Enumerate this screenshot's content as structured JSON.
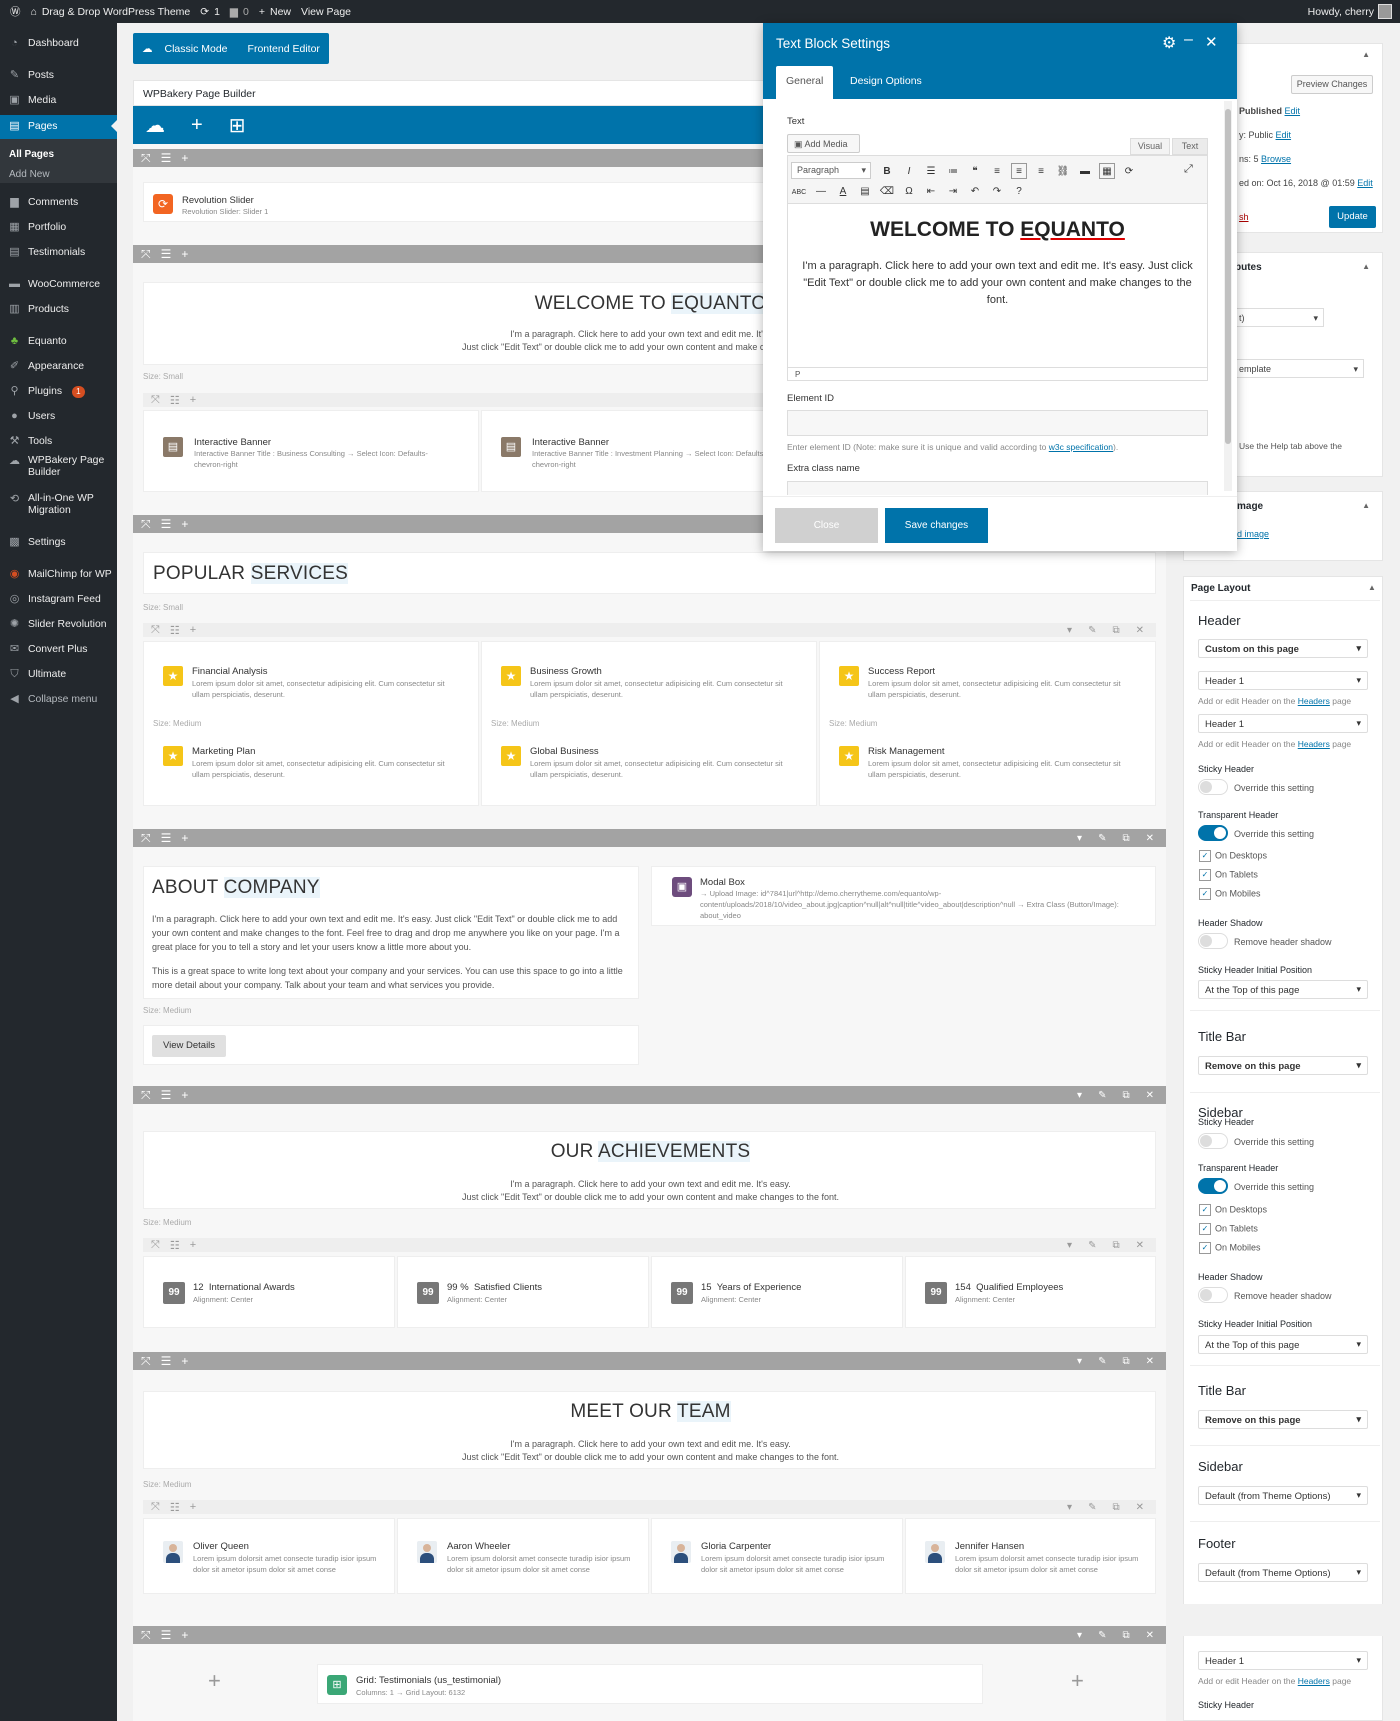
{
  "adminbar": {
    "site": "Drag & Drop WordPress Theme",
    "updates": "1",
    "comments": "0",
    "new": "New",
    "view": "View Page",
    "howdy": "Howdy, cherry"
  },
  "sidebar": {
    "items": [
      "Dashboard",
      "Posts",
      "Media",
      "Pages",
      "Comments",
      "Portfolio",
      "Testimonials",
      "WooCommerce",
      "Products",
      "Equanto",
      "Appearance",
      "Plugins",
      "Users",
      "Tools",
      "WPBakery Page Builder",
      "All-in-One WP Migration",
      "Settings",
      "MailChimp for WP",
      "Instagram Feed",
      "Slider Revolution",
      "Convert Plus",
      "Ultimate",
      "Collapse menu"
    ],
    "subs": [
      "All Pages",
      "Add New"
    ],
    "plugins_badge": "1"
  },
  "editor": {
    "classic": "Classic Mode",
    "frontend": "Frontend Editor",
    "builder_title": "WPBakery Page Builder",
    "rev_title": "Revolution Slider",
    "rev_desc": "Revolution Slider: Slider 1",
    "welcome_a": "WELCOME TO",
    "welcome_b": "EQUANTO",
    "para1": "I'm a paragraph. Click here to add your own text and edit me. It's easy.",
    "para2": "Just click \"Edit Text\" or double click me to add your own content and make changes to the font.",
    "size_small": "Size: Small",
    "size_medium": "Size: Medium",
    "ib1_title": "Interactive Banner",
    "ib1_desc": "Interactive Banner Title : Business Consulting → Select Icon: Defaults-chevron-right",
    "ib2_title": "Interactive Banner",
    "ib2_desc": "Interactive Banner Title : Investment Planning → Select Icon: Defaults-chevron-right",
    "pop_a": "POPULAR",
    "pop_b": "SERVICES",
    "lorem": "Lorem ipsum dolor sit amet, consectetur adipisicing elit. Cum consectetur sit ullam perspiciatis, deserunt.",
    "services": [
      "Financial Analysis",
      "Business Growth",
      "Success Report",
      "Marketing Plan",
      "Global Business",
      "Risk Management"
    ],
    "about_a": "ABOUT",
    "about_b": "COMPANY",
    "about_p1": "I'm a paragraph. Click here to add your own text and edit me. It's easy. Just click \"Edit Text\" or double click me to add your own content and make changes to the font. Feel free to drag and drop me anywhere you like on your page. I'm a great place for you to tell a story and let your users know a little more about you.",
    "about_p2": "This is a great space to write long text about your company and your services. You can use this space to go into a little more detail about your company. Talk about your team and what services you provide.",
    "view_details": "View Details",
    "modal_title": "Modal Box",
    "modal_desc": "→ Upload Image: id^7841|url^http://demo.cherrytheme.com/equanto/wp-content/uploads/2018/10/video_about.jpg|caption^null|alt^null|title^video_about|description^null → Extra Class (Button/Image): about_video",
    "ach_a": "OUR",
    "ach_b": "ACHIEVEMENTS",
    "counters": [
      {
        "n": "12",
        "t": "International Awards"
      },
      {
        "n": "99 %",
        "t": "Satisfied Clients"
      },
      {
        "n": "15",
        "t": "Years of Experience"
      },
      {
        "n": "154",
        "t": "Qualified Employees"
      }
    ],
    "counter_icon": "99",
    "alignment": "Alignment: Center",
    "team_a": "MEET OUR",
    "team_b": "TEAM",
    "team": [
      "Oliver Queen",
      "Aaron Wheeler",
      "Gloria Carpenter",
      "Jennifer Hansen"
    ],
    "team_desc": "Lorem ipsum dolorsit amet consecte turadip isior ipsum dolor sit ametor ipsum dolor sit amet conse",
    "grid_title": "Grid: Testimonials (us_testimonial)",
    "grid_desc": "Columns: 1 → Grid Layout: 6132"
  },
  "modal": {
    "title": "Text Block Settings",
    "tab_general": "General",
    "tab_design": "Design Options",
    "text_label": "Text",
    "add_media": "Add Media",
    "visual": "Visual",
    "text": "Text",
    "paragraph": "Paragraph",
    "heading_a": "WELCOME TO",
    "heading_b": "EQUANTO",
    "body": "I'm a paragraph. Click here to add your own text and edit me. It's easy. Just click \"Edit Text\" or double click me to add your own content and make changes to the font.",
    "path": "P",
    "element_id": "Element ID",
    "element_hint": "Enter element ID (Note: make sure it is unique and valid according to",
    "w3c": "w3c specification",
    "extra": "Extra class name",
    "close": "Close",
    "save": "Save changes"
  },
  "publish": {
    "preview": "Preview Changes",
    "status": "Published",
    "edit": "Edit",
    "visibility": "y: Public",
    "revisions": "ns: 5",
    "browse": "Browse",
    "date": "ed on: Oct 16, 2018 @ 01:59",
    "trash": "sh",
    "update": "Update"
  },
  "attributes": {
    "title": "butes",
    "sel1": "t)",
    "sel2": "emplate",
    "help": "Use the Help tab above the"
  },
  "featured": {
    "title": "mage",
    "link": "d image"
  },
  "layout": {
    "title": "Page Layout",
    "header": "Header",
    "custom": "Custom on this page",
    "header1": "Header 1",
    "hint_a": "Add or edit Header on the",
    "hint_link": "Headers",
    "hint_b": "page",
    "sticky": "Sticky Header",
    "override": "Override this setting",
    "transparent": "Transparent Header",
    "desktops": "On Desktops",
    "tablets": "On Tablets",
    "mobiles": "On Mobiles",
    "shadow": "Header Shadow",
    "remove_shadow": "Remove header shadow",
    "sticky_pos": "Sticky Header Initial Position",
    "top": "At the Top of this page",
    "titlebar": "Title Bar",
    "remove": "Remove on this page",
    "sidebar": "Sidebar",
    "default": "Default (from Theme Options)",
    "footer": "Footer"
  }
}
